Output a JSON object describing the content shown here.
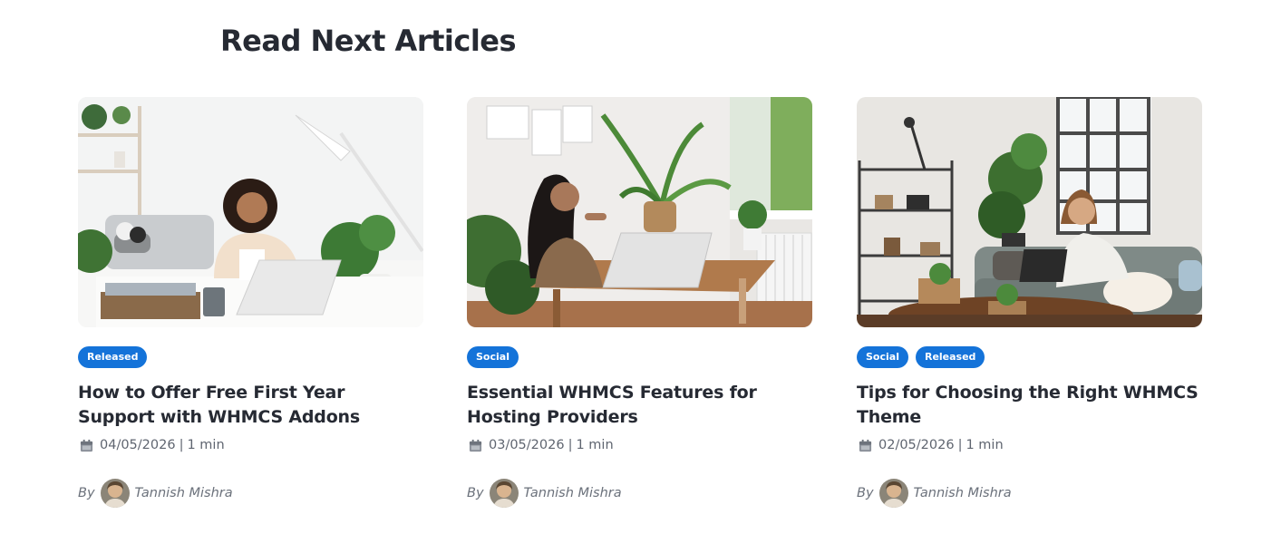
{
  "section": {
    "title": "Read Next Articles"
  },
  "articles": [
    {
      "image_alt": "Woman working on laptop at white desk in bright room with plants",
      "tags": [
        "Released"
      ],
      "title": "How to Offer Free First Year Support with WHMCS Addons",
      "date": "04/05/2026",
      "separator": "|",
      "read_time": "1 min",
      "by_label": "By",
      "author": "Tannish Mishra"
    },
    {
      "image_alt": "Woman at wooden desk with laptop next to window and plants",
      "tags": [
        "Social"
      ],
      "title": "Essential WHMCS Features for Hosting Providers",
      "date": "03/05/2026",
      "separator": "|",
      "read_time": "1 min",
      "by_label": "By",
      "author": "Tannish Mishra"
    },
    {
      "image_alt": "Woman sitting on grey sofa with laptop in loft living room",
      "tags": [
        "Social",
        "Released"
      ],
      "title": "Tips for Choosing the Right WHMCS Theme",
      "date": "02/05/2026",
      "separator": "|",
      "read_time": "1 min",
      "by_label": "By",
      "author": "Tannish Mishra"
    }
  ],
  "colors": {
    "tag_bg": "#1473d9",
    "tag_text": "#ffffff",
    "title": "#262a33",
    "meta": "#5f6570"
  },
  "icons": {
    "meta": "calendar-icon"
  }
}
